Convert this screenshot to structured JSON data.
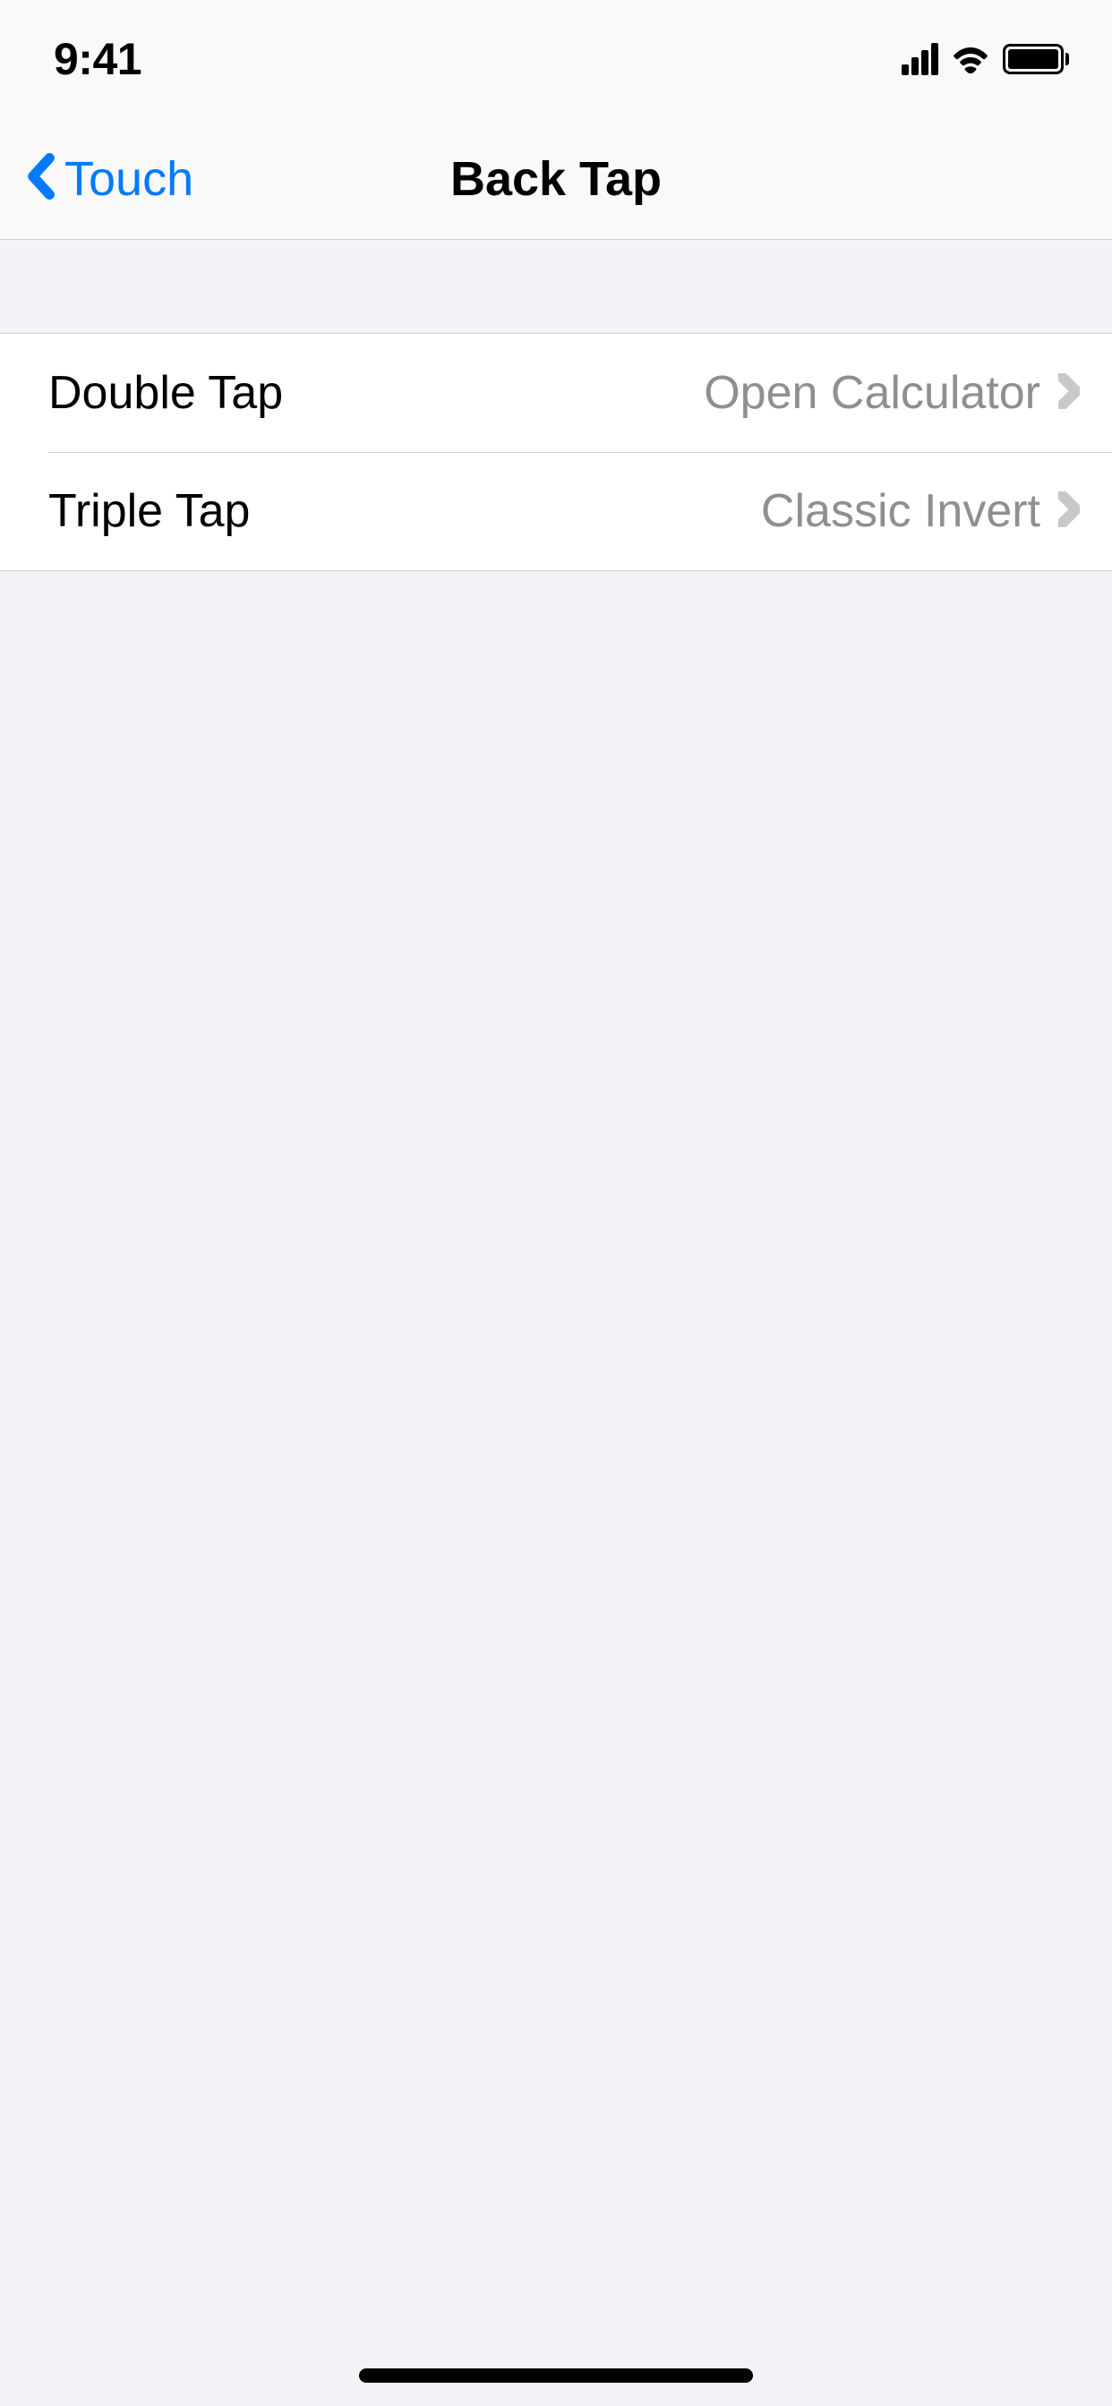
{
  "status": {
    "time": "9:41"
  },
  "nav": {
    "back_label": "Touch",
    "title": "Back Tap"
  },
  "rows": [
    {
      "label": "Double Tap",
      "value": "Open Calculator"
    },
    {
      "label": "Triple Tap",
      "value": "Classic Invert"
    }
  ]
}
